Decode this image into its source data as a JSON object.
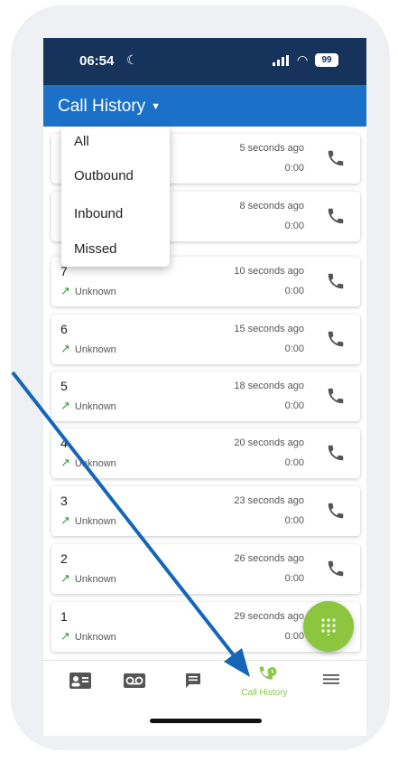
{
  "status_bar": {
    "time": "06:54",
    "battery": "99"
  },
  "app_bar": {
    "title": "Call History"
  },
  "filter_menu": {
    "options": [
      "All",
      "Outbound",
      "Inbound",
      "Missed"
    ]
  },
  "calls": [
    {
      "number": "",
      "direction": "",
      "ago": "5 seconds ago",
      "duration": "0:00"
    },
    {
      "number": "",
      "direction": "",
      "ago": "8 seconds ago",
      "duration": "0:00"
    },
    {
      "number": "7",
      "direction": "Unknown",
      "ago": "10 seconds ago",
      "duration": "0:00"
    },
    {
      "number": "6",
      "direction": "Unknown",
      "ago": "15 seconds ago",
      "duration": "0:00"
    },
    {
      "number": "5",
      "direction": "Unknown",
      "ago": "18 seconds ago",
      "duration": "0:00"
    },
    {
      "number": "4",
      "direction": "Unknown",
      "ago": "20 seconds ago",
      "duration": "0:00"
    },
    {
      "number": "3",
      "direction": "Unknown",
      "ago": "23 seconds ago",
      "duration": "0:00"
    },
    {
      "number": "2",
      "direction": "Unknown",
      "ago": "26 seconds ago",
      "duration": "0:00"
    },
    {
      "number": "1",
      "direction": "Unknown",
      "ago": "29 seconds ago",
      "duration": "0:00"
    }
  ],
  "bottom_nav": {
    "items": [
      {
        "icon": "contacts-icon"
      },
      {
        "icon": "voicemail-icon"
      },
      {
        "icon": "messages-icon"
      },
      {
        "icon": "call-history-icon",
        "label": "Call History",
        "active": true
      },
      {
        "icon": "menu-icon"
      }
    ]
  },
  "colors": {
    "status_bar": "#16345b",
    "app_bar": "#1b71c7",
    "accent": "#8cc63f",
    "annotation_arrow": "#1565b8"
  }
}
